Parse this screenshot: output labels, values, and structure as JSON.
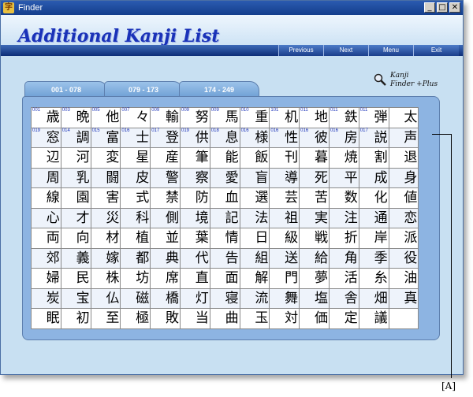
{
  "window": {
    "title": "Finder"
  },
  "header": {
    "title": "Additional Kanji List"
  },
  "nav": [
    "Previous",
    "Next",
    "Menu",
    "Exit"
  ],
  "tabs": [
    "001 - 078",
    "079 - 173",
    "174 - 249"
  ],
  "finder_label": {
    "line1": "Kanji",
    "line2": "Finder +Plus"
  },
  "callout": "[A]",
  "rows": [
    [
      "歳",
      "晩",
      "他",
      "々",
      "輸",
      "努",
      "馬",
      "重",
      "机",
      "地",
      "鉄",
      "弾",
      "太"
    ],
    [
      "窓",
      "調",
      "富",
      "士",
      "登",
      "供",
      "息",
      "様",
      "性",
      "彼",
      "房",
      "説",
      "声"
    ],
    [
      "辺",
      "河",
      "変",
      "星",
      "産",
      "筆",
      "能",
      "飯",
      "刊",
      "暮",
      "焼",
      "割",
      "退"
    ],
    [
      "周",
      "乳",
      "闘",
      "皮",
      "警",
      "察",
      "愛",
      "盲",
      "導",
      "死",
      "平",
      "成",
      "身"
    ],
    [
      "線",
      "園",
      "害",
      "式",
      "禁",
      "防",
      "血",
      "選",
      "芸",
      "苦",
      "数",
      "化",
      "値"
    ],
    [
      "心",
      "才",
      "災",
      "科",
      "側",
      "境",
      "記",
      "法",
      "祖",
      "実",
      "注",
      "通",
      "恋"
    ],
    [
      "両",
      "向",
      "材",
      "植",
      "並",
      "葉",
      "情",
      "日",
      "級",
      "戦",
      "折",
      "岸",
      "派"
    ],
    [
      "郊",
      "義",
      "嫁",
      "都",
      "典",
      "代",
      "告",
      "組",
      "送",
      "給",
      "角",
      "季",
      "役"
    ],
    [
      "婦",
      "民",
      "株",
      "坊",
      "席",
      "直",
      "面",
      "解",
      "門",
      "夢",
      "活",
      "糸",
      "油"
    ],
    [
      "炭",
      "宝",
      "仏",
      "磁",
      "橋",
      "灯",
      "寝",
      "流",
      "舞",
      "塩",
      "舎",
      "畑",
      "真"
    ],
    [
      "眠",
      "初",
      "至",
      "極",
      "敗",
      "当",
      "曲",
      "玉",
      "対",
      "価",
      "定",
      "議"
    ]
  ],
  "nums": [
    [
      "001",
      "003",
      "005",
      "007",
      "009",
      "009",
      "009",
      "010",
      "101",
      "011",
      "011",
      "011"
    ],
    [
      "019",
      "014",
      "015",
      "016",
      "017",
      "019",
      "018",
      "016",
      "016",
      "016",
      "016",
      "017"
    ]
  ]
}
